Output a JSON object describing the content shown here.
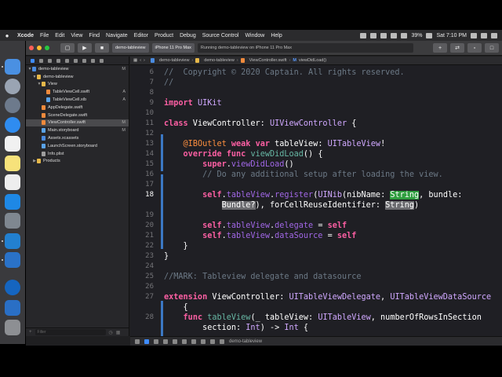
{
  "menubar": {
    "app": "Xcode",
    "items": [
      "File",
      "Edit",
      "View",
      "Find",
      "Navigate",
      "Editor",
      "Product",
      "Debug",
      "Source Control",
      "Window",
      "Help"
    ],
    "battery": "39%",
    "clock": "Sat 7:10 PM"
  },
  "toolbar": {
    "scheme": "demo-tableview",
    "device": "iPhone 11 Pro Max",
    "status": "Running demo-tableview on iPhone 11 Pro Max"
  },
  "jumpbar": {
    "crumbs": [
      "demo-tableview",
      "demo-tableview",
      "ViewController.swift",
      "viewDidLoad()"
    ]
  },
  "navigator": {
    "items": [
      {
        "label": "demo-tableview",
        "badge": "M"
      },
      {
        "label": "demo-tableview",
        "badge": ""
      },
      {
        "label": "View",
        "badge": ""
      },
      {
        "label": "TableViewCell.swift",
        "badge": "A"
      },
      {
        "label": "TableViewCell.xib",
        "badge": "A"
      },
      {
        "label": "AppDelegate.swift",
        "badge": ""
      },
      {
        "label": "SceneDelegate.swift",
        "badge": ""
      },
      {
        "label": "ViewController.swift",
        "badge": "M"
      },
      {
        "label": "Main.storyboard",
        "badge": "M"
      },
      {
        "label": "Assets.xcassets",
        "badge": ""
      },
      {
        "label": "LaunchScreen.storyboard",
        "badge": ""
      },
      {
        "label": "Info.plist",
        "badge": ""
      },
      {
        "label": "Products",
        "badge": ""
      }
    ],
    "filter_placeholder": "Filter"
  },
  "debugbar": {
    "target": "demo-tableview"
  },
  "code": {
    "numbers": [
      "6",
      "7",
      "8",
      "9",
      "10",
      "11",
      "12",
      "13",
      "14",
      "15",
      "16",
      "17",
      "18",
      "",
      "19",
      "20",
      "21",
      "22",
      "23",
      "24",
      "25",
      "26",
      "27",
      "",
      "28",
      ""
    ],
    "current_line": "18",
    "lines": [
      "//  Copyright © 2020 Captain. All rights reserved.",
      "//",
      "",
      "import UIKit",
      "",
      "class ViewController: UIViewController {",
      "",
      "    @IBOutlet weak var tableView: UITableView!",
      "    override func viewDidLoad() {",
      "        super.viewDidLoad()",
      "        // Do any additional setup after loading the view.",
      "",
      "        self.tableView.register(UINib(nibName: String, bundle:",
      "            Bundle?), forCellReuseIdentifier: String)",
      "",
      "        self.tableView.delegate = self",
      "        self.tableView.dataSource = self",
      "    }",
      "}",
      "",
      "//MARK: Tableview delegate and datasource",
      "",
      "extension ViewController: UITableViewDelegate, UITableViewDataSource",
      "    {",
      "    func tableView(_ tableView: UITableView, numberOfRowsInSection",
      "        section: Int) -> Int {"
    ]
  },
  "colors": {
    "editor_bg": "#1f1f24",
    "keyword": "#fc5fa3",
    "type": "#d0a8ff",
    "comment": "#6c7986",
    "placeholder_selected": "#2f9e3f"
  }
}
